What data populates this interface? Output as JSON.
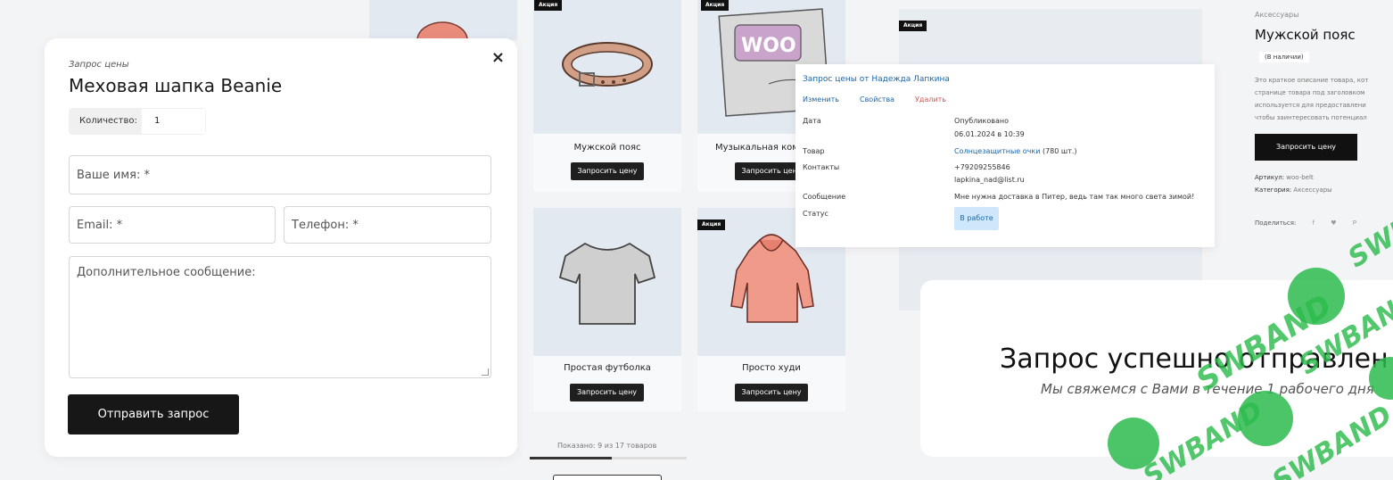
{
  "products": [
    {
      "name": "Мужской пояс",
      "button": "Запросить цену",
      "badge": "Акция",
      "art": "belt"
    },
    {
      "name": "Музыкальная комп",
      "button": "Запросить цену",
      "badge": "Акция",
      "art": "woo-album"
    },
    {
      "name": "Простая футболка",
      "button": "Запросить цену",
      "badge": "",
      "art": "tshirt"
    },
    {
      "name": "Просто худи",
      "button": "Запросить цену",
      "badge": "Акция",
      "art": "hoodie"
    }
  ],
  "pagination": {
    "text": "Показано: 9 из 17 товаров"
  },
  "price_request_modal": {
    "small_title": "Запрос цены",
    "title": "Меховая шапка Beanie",
    "quantity_label": "Количество:",
    "quantity_value": "1",
    "name_placeholder": "Ваше имя: *",
    "email_placeholder": "Email: *",
    "phone_placeholder": "Телефон: *",
    "message_placeholder": "Дополнительное сообщение:",
    "submit_label": "Отправить запрос",
    "close_icon": "×"
  },
  "admin_popup": {
    "title": "Запрос цены от Надежда Лапкина",
    "actions": {
      "edit": "Изменить",
      "properties": "Свойства",
      "delete": "Удалить"
    },
    "rows": {
      "date_label": "Дата",
      "date_value_1": "Опубликовано",
      "date_value_2": "06.01.2024 в 10:39",
      "product_label": "Товар",
      "product_link": "Солнцезащитные очки",
      "product_count": "(780 шт.)",
      "contacts_label": "Контакты",
      "phone": "+79209255846",
      "email": "lapkina_nad@list.ru",
      "message_label": "Сообщение",
      "message_value": "Мне нужна доставка в Питер, ведь там так много света зимой!",
      "status_label": "Статус",
      "status_value": "В работе"
    },
    "colors": {
      "link": "#1c66a8",
      "delete": "#d9534f",
      "status_bg": "#cfe7fb"
    }
  },
  "product_panel": {
    "category": "Аксессуары",
    "title": "Мужской пояс",
    "stock": "(В наличии)",
    "desc_lines": [
      "Это краткое описание товара, кот",
      "странице товара под заголовком",
      "используется для предоставлени",
      "чтобы заинтересовать потенциал"
    ],
    "button": "Запросить цену",
    "sku_label": "Артикул:",
    "sku_value": "woo-belt",
    "cat_label": "Категория:",
    "cat_value": "Аксессуары",
    "share_label": "Поделиться:",
    "share_icons": [
      "f",
      "♥",
      "P"
    ],
    "badge": "Акция"
  },
  "success_card": {
    "title": "Запрос успешно отправлен",
    "subtitle": "Мы свяжемся с Вами в течение 1 рабочего дня"
  },
  "watermark": {
    "text": "SWBAND",
    "letter": "S",
    "color": "#2cbb4c"
  }
}
